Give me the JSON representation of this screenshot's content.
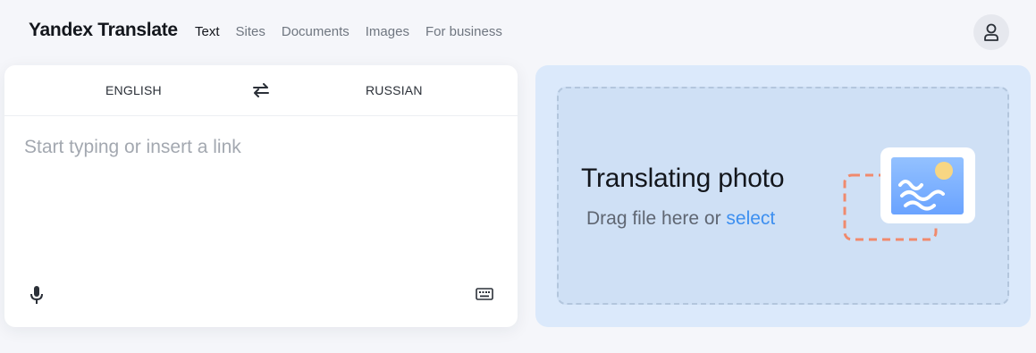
{
  "header": {
    "logo": "Yandex Translate",
    "nav": [
      "Text",
      "Sites",
      "Documents",
      "Images",
      "For business"
    ]
  },
  "translator": {
    "source_lang": "ENGLISH",
    "target_lang": "RUSSIAN",
    "placeholder": "Start typing or insert a link"
  },
  "photo": {
    "title": "Translating photo",
    "subtitle_prefix": "Drag file here or ",
    "select_link": "select"
  },
  "colors": {
    "accent": "#3d8ff0",
    "dropzone_bg": "#cfe0f5",
    "frame_dash": "#f08a6d"
  },
  "icons": [
    "user-icon",
    "swap-icon",
    "microphone-icon",
    "keyboard-icon",
    "image-icon"
  ]
}
